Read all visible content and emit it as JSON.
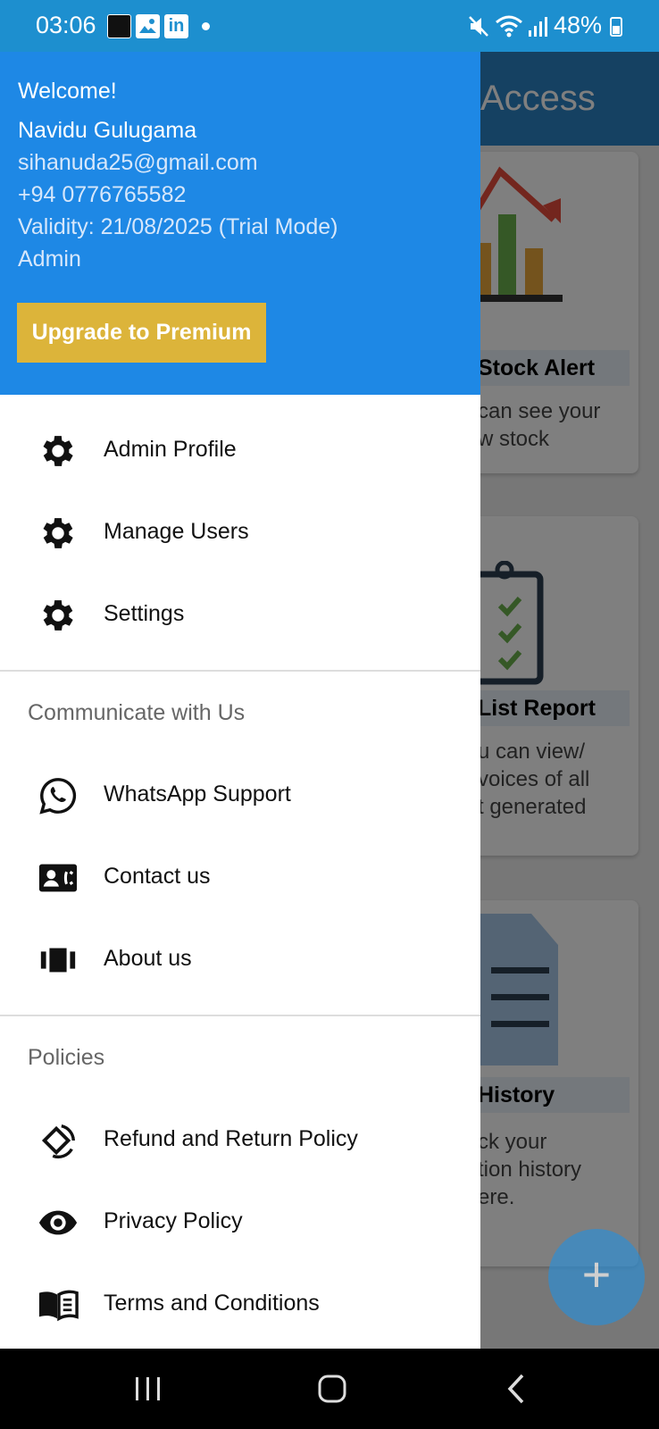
{
  "status_bar": {
    "time": "03:06",
    "linkedin_glyph": "in",
    "battery": "48%",
    "icons": [
      "app-thumbnail-icon",
      "gallery-icon",
      "linkedin-icon",
      "mute-icon",
      "wifi-icon",
      "signal-icon",
      "battery-icon"
    ]
  },
  "background_screen": {
    "title": "Access",
    "cards": [
      {
        "title": "Stock Alert",
        "text": [
          "can see your",
          "w stock"
        ]
      },
      {
        "title": "List Report",
        "text": [
          "u can view/",
          "voices of all",
          "t generated"
        ]
      },
      {
        "title": "History",
        "text": [
          "ck your",
          "tion history",
          "ere."
        ]
      }
    ],
    "fab_label": "+"
  },
  "drawer": {
    "header": {
      "welcome": "Welcome!",
      "name": "Navidu Gulugama",
      "email": "sihanuda25@gmail.com",
      "phone": "+94 0776765582",
      "validity": "Validity: 21/08/2025 (Trial Mode)",
      "role": "Admin",
      "upgrade_button": "Upgrade to Premium"
    },
    "main_items": [
      {
        "label": "Admin Profile",
        "icon": "gear-icon"
      },
      {
        "label": "Manage Users",
        "icon": "gear-icon"
      },
      {
        "label": "Settings",
        "icon": "gear-icon"
      }
    ],
    "communicate_section": {
      "title": "Communicate with Us",
      "items": [
        {
          "label": "WhatsApp Support",
          "icon": "whatsapp-icon"
        },
        {
          "label": "Contact us",
          "icon": "contact-card-icon"
        },
        {
          "label": "About us",
          "icon": "view-carousel-icon"
        }
      ]
    },
    "policies_section": {
      "title": "Policies",
      "items": [
        {
          "label": "Refund and Return Policy",
          "icon": "refund-rotate-icon"
        },
        {
          "label": "Privacy Policy",
          "icon": "eye-icon"
        },
        {
          "label": "Terms and Conditions",
          "icon": "book-icon"
        }
      ]
    }
  },
  "nav_bar": {
    "buttons": [
      "recent-apps-icon",
      "home-icon",
      "back-icon"
    ]
  }
}
